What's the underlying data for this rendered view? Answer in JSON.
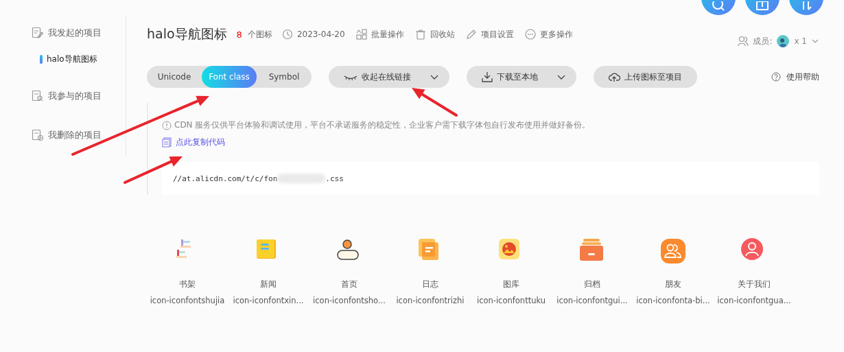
{
  "top_buttons": [
    {
      "kind": "search"
    },
    {
      "kind": "add"
    },
    {
      "kind": "sort"
    }
  ],
  "sidebar": {
    "sections": [
      {
        "kind": "mine",
        "label": "我发起的项目",
        "children": [
          {
            "label": "halo导航图标",
            "selected": true
          }
        ]
      },
      {
        "kind": "joined",
        "label": "我参与的项目"
      },
      {
        "kind": "deleted",
        "label": "我删除的项目"
      }
    ]
  },
  "project": {
    "title": "halo导航图标",
    "count": "8",
    "count_label": "个图标",
    "actions": [
      {
        "kind": "date",
        "label": "2023-04-20"
      },
      {
        "kind": "batch",
        "label": "批量操作"
      },
      {
        "kind": "trash",
        "label": "回收站"
      },
      {
        "kind": "settings",
        "label": "项目设置"
      },
      {
        "kind": "more",
        "label": "更多操作"
      }
    ],
    "members": {
      "label": "成员:",
      "count": "x 1"
    }
  },
  "toolbar": {
    "tabs": [
      {
        "label": "Unicode",
        "selected": false
      },
      {
        "label": "Font class",
        "selected": true
      },
      {
        "label": "Symbol",
        "selected": false
      }
    ],
    "buttons": [
      {
        "kind": "collapse",
        "label": "收起在线链接",
        "dropdown": true
      },
      {
        "kind": "download",
        "label": "下载至本地",
        "dropdown": true
      },
      {
        "kind": "upload",
        "label": "上传图标至项目",
        "dropdown": false
      }
    ],
    "help": "使用帮助"
  },
  "notice": "CDN 服务仅供平台体验和调试使用，平台不承诺服务的稳定性，企业客户需下载字体包自行发布使用并做好备份。",
  "copy_link": "点此复制代码",
  "code": {
    "before": "//at.alicdn.com/t/c/fon",
    "after": ".css"
  },
  "icons": [
    {
      "name": "书架",
      "code": "icon-iconfontshujia"
    },
    {
      "name": "新闻",
      "code": "icon-iconfontxin..."
    },
    {
      "name": "首页",
      "code": "icon-iconfontsho..."
    },
    {
      "name": "日志",
      "code": "icon-iconfontrizhi"
    },
    {
      "name": "图库",
      "code": "icon-iconfonttuku"
    },
    {
      "name": "归档",
      "code": "icon-iconfontgui..."
    },
    {
      "name": "朋友",
      "code": "icon-iconfonta-bi..."
    },
    {
      "name": "关于我们",
      "code": "icon-iconfontgua..."
    }
  ]
}
